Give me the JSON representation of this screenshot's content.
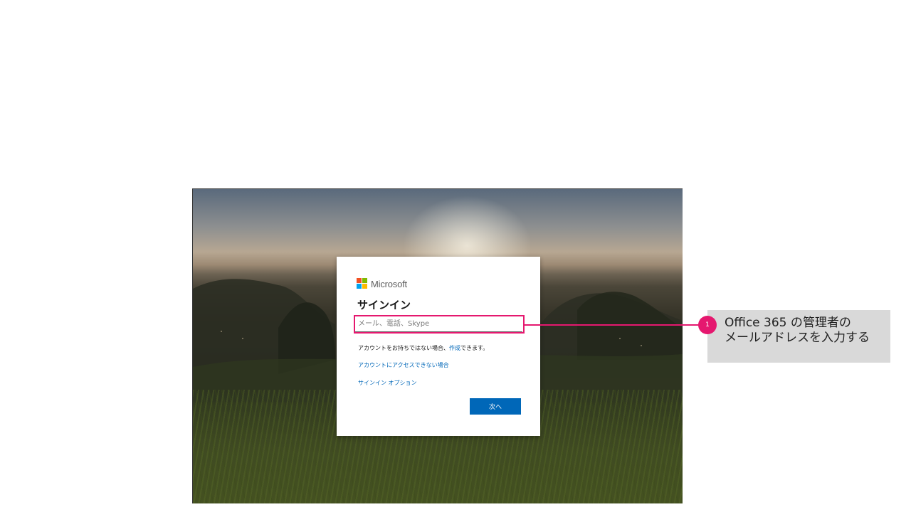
{
  "signin": {
    "brand": "Microsoft",
    "title": "サインイン",
    "email_placeholder": "メール、電話、Skype",
    "no_account_prefix": "アカウントをお持ちではない場合、",
    "create_link": "作成",
    "no_account_suffix": "できます。",
    "cant_access_link": "アカウントにアクセスできない場合",
    "signin_options_link": "サインイン オプション",
    "next_button": "次へ"
  },
  "callout": {
    "number": "1",
    "line1": "Office 365 の管理者の",
    "line2": "メールアドレスを入力する"
  },
  "colors": {
    "highlight": "#e5186f",
    "primary_button": "#0067b8",
    "link": "#0067b8",
    "callout_bg": "#d9d9d9",
    "ms_red": "#f25022",
    "ms_green": "#7fba00",
    "ms_blue": "#00a4ef",
    "ms_yellow": "#ffb900"
  },
  "icons": {
    "logo": "microsoft-logo-icon"
  }
}
